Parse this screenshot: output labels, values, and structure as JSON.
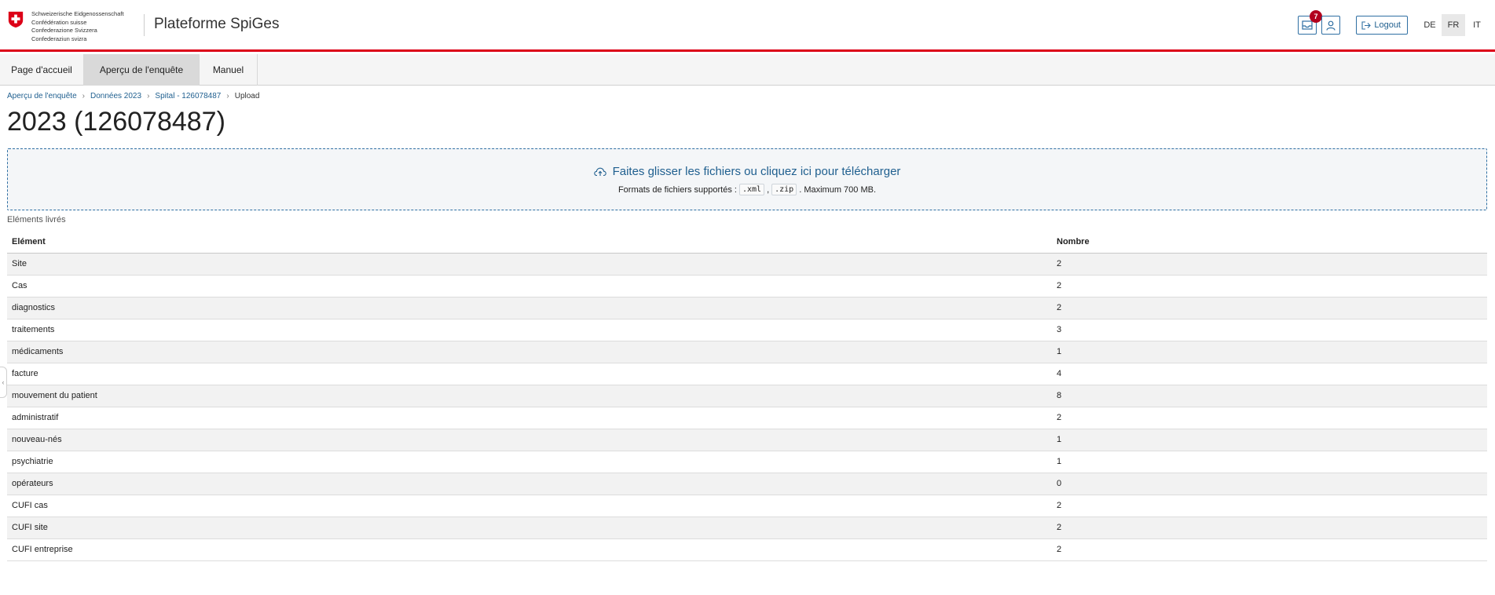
{
  "header": {
    "confederation_lines": [
      "Schweizerische Eidgenossenschaft",
      "Confédération suisse",
      "Confederazione Svizzera",
      "Confederaziun svizra"
    ],
    "app_title": "Plateforme SpiGes",
    "notification_count": "7",
    "logout_label": "Logout",
    "languages": [
      "DE",
      "FR",
      "IT"
    ],
    "active_language": "FR"
  },
  "nav": {
    "items": [
      "Page d'accueil",
      "Aperçu de l'enquête",
      "Manuel"
    ],
    "active": "Aperçu de l'enquête"
  },
  "breadcrumb": [
    "Aperçu de l'enquête",
    "Données 2023",
    "Spital - 126078487",
    "Upload"
  ],
  "page_title": "2023 (126078487)",
  "dropzone": {
    "main_text": "Faites glisser les fichiers ou cliquez ici pour télécharger",
    "formats_prefix": "Formats de fichiers supportés :",
    "format_1": ".xml",
    "format_sep": ",",
    "format_2": ".zip",
    "formats_suffix": ". Maximum 700 MB."
  },
  "section_label": "Eléments livrés",
  "table": {
    "headers": [
      "Elément",
      "Nombre"
    ],
    "rows": [
      [
        "Site",
        "2"
      ],
      [
        "Cas",
        "2"
      ],
      [
        "diagnostics",
        "2"
      ],
      [
        "traitements",
        "3"
      ],
      [
        "médicaments",
        "1"
      ],
      [
        "facture",
        "4"
      ],
      [
        "mouvement du patient",
        "8"
      ],
      [
        "administratif",
        "2"
      ],
      [
        "nouveau-nés",
        "1"
      ],
      [
        "psychiatrie",
        "1"
      ],
      [
        "opérateurs",
        "0"
      ],
      [
        "CUFI cas",
        "2"
      ],
      [
        "CUFI site",
        "2"
      ],
      [
        "CUFI entreprise",
        "2"
      ]
    ]
  },
  "colors": {
    "accent_red": "#dc0018",
    "link_blue": "#1f5f8f",
    "badge_red": "#b2001d"
  }
}
